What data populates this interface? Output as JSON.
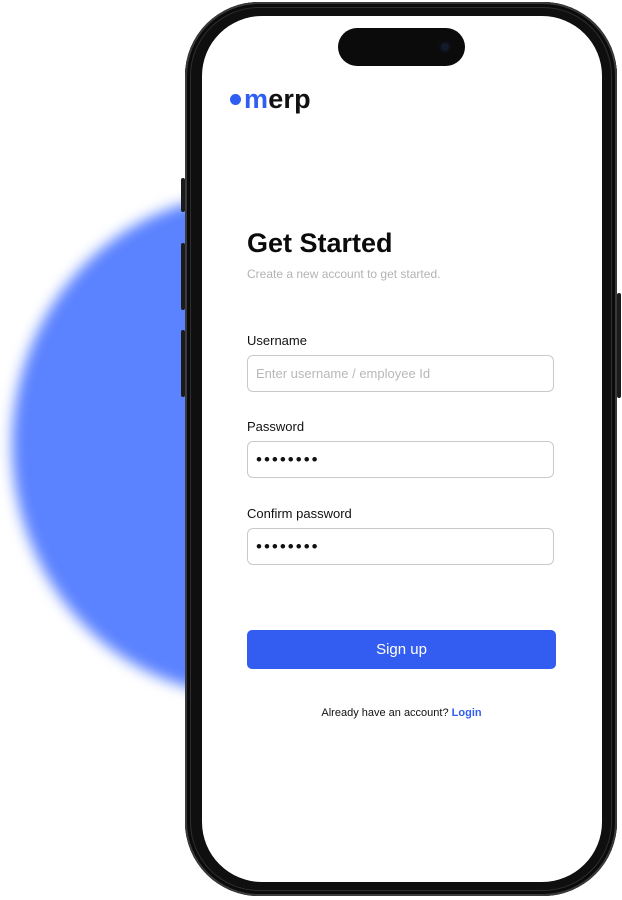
{
  "brand": {
    "dot": "",
    "initial": "m",
    "rest": "erp",
    "color": "#2f5ef2"
  },
  "header": {
    "title": "Get Started",
    "subtitle": "Create a new account to get started."
  },
  "form": {
    "username": {
      "label": "Username",
      "placeholder": "Enter username / employee Id",
      "value": ""
    },
    "password": {
      "label": "Password",
      "value": "••••••••"
    },
    "confirm_password": {
      "label": "Confirm password",
      "value": "••••••••"
    },
    "submit_label": "Sign up"
  },
  "footer": {
    "prompt": "Already have an account?",
    "link_label": "Login"
  },
  "colors": {
    "accent": "#335cf0",
    "backdrop_blob": "#5b82ff"
  }
}
